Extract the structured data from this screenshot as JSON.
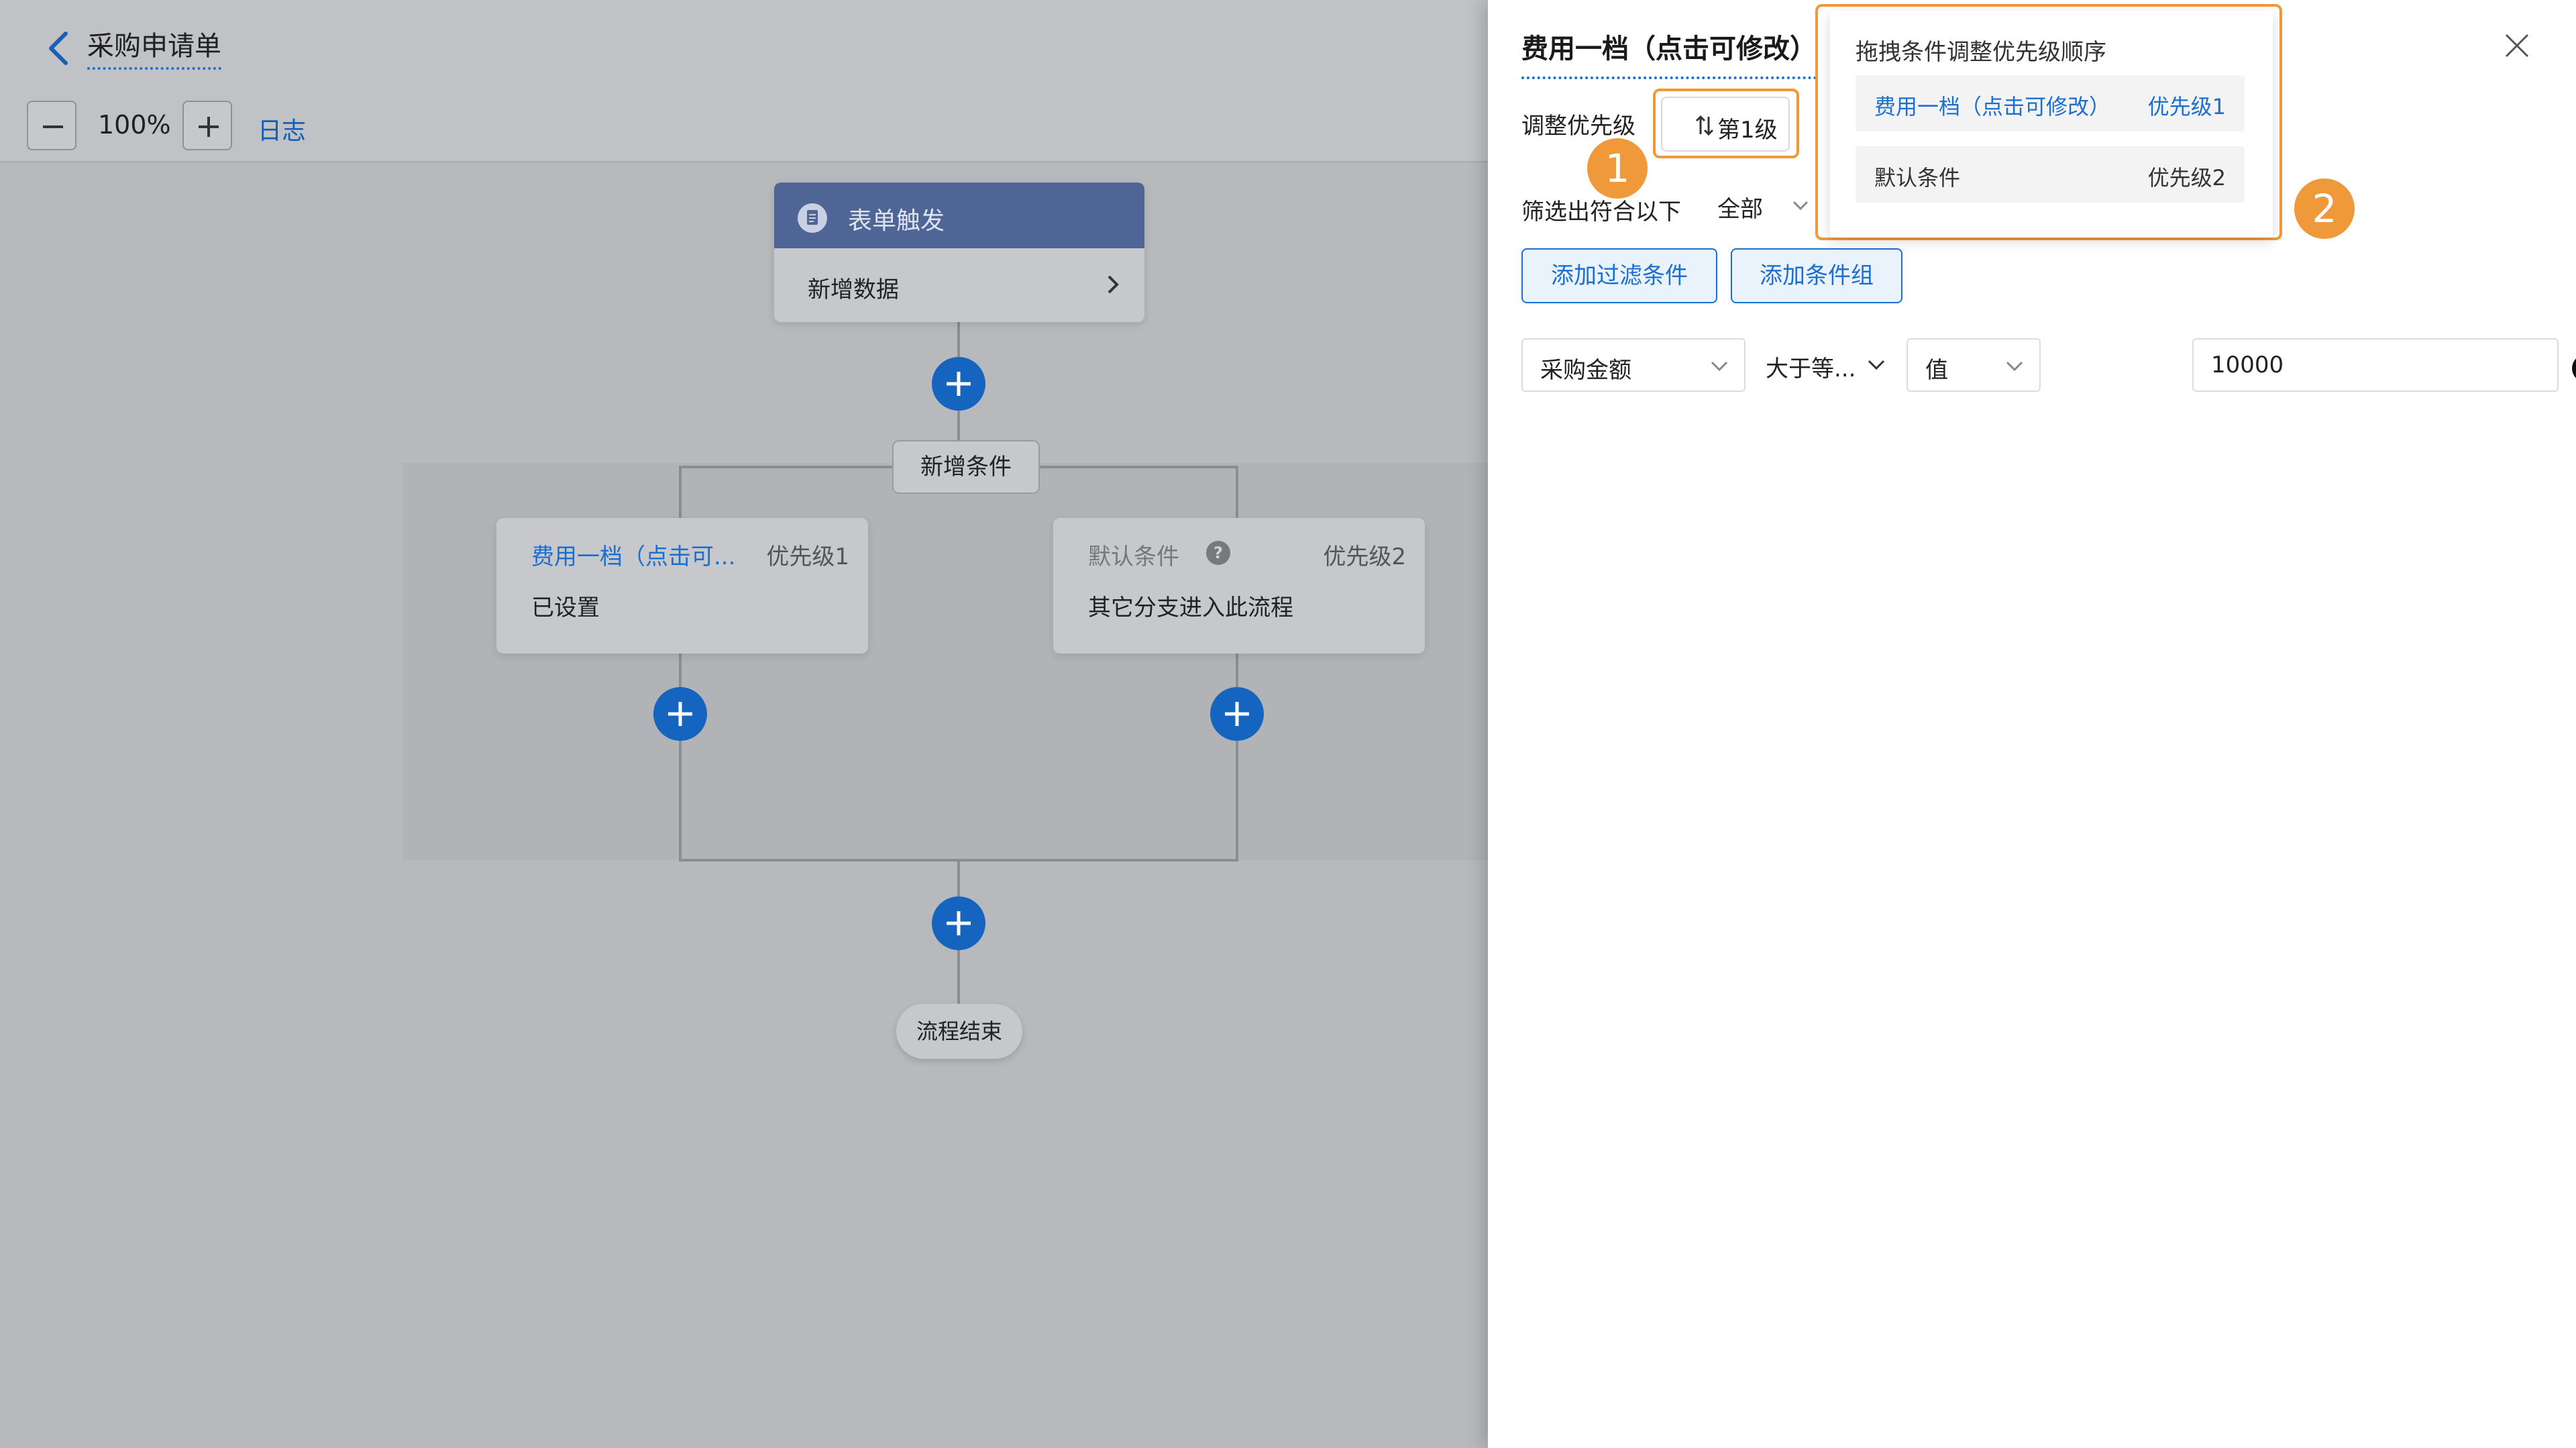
{
  "header": {
    "title": "采购申请单",
    "zoom": "100%",
    "log_label": "日志"
  },
  "flow": {
    "trigger": {
      "title": "表单触发",
      "body": "新增数据"
    },
    "add_condition_label": "新增条件",
    "conditions": [
      {
        "title": "费用一档（点击可...",
        "priority": "优先级1",
        "subtitle": "已设置"
      },
      {
        "title": "默认条件",
        "priority": "优先级2",
        "subtitle": "其它分支进入此流程"
      }
    ],
    "end_label": "流程结束"
  },
  "panel": {
    "title": "费用一档（点击可修改）",
    "priority_label": "调整优先级",
    "priority_button": "第1级",
    "filter_label": "筛选出符合以下",
    "filter_value": "全部",
    "add_filter_label": "添加过滤条件",
    "add_group_label": "添加条件组",
    "rule": {
      "field": "采购金额",
      "operator": "大于等...",
      "value_type": "值",
      "value": "10000"
    }
  },
  "popover": {
    "title": "拖拽条件调整优先级顺序",
    "items": [
      {
        "name": "费用一档（点击可修改）",
        "priority": "优先级1"
      },
      {
        "name": "默认条件",
        "priority": "优先级2"
      }
    ]
  },
  "markers": {
    "one": "1",
    "two": "2"
  },
  "colors": {
    "accent": "#1a6fd1",
    "highlight": "#f0993a",
    "trigger_header": "#4f6596",
    "add_button": "#1565c0"
  },
  "icons": [
    "back-icon",
    "minus-icon",
    "plus-icon",
    "document-icon",
    "chevron-right-icon",
    "help-icon",
    "sort-icon",
    "chevron-down-icon",
    "close-icon",
    "add-circle-icon",
    "remove-circle-icon"
  ]
}
